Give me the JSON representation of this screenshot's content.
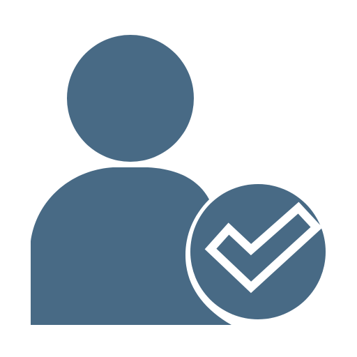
{
  "icon": {
    "name": "user-verified-icon",
    "parts": [
      "user-head",
      "user-body",
      "check-badge",
      "checkmark"
    ]
  },
  "colors": {
    "primary": "#486a85",
    "background": "#ffffff",
    "check_fill": "#ffffff"
  }
}
